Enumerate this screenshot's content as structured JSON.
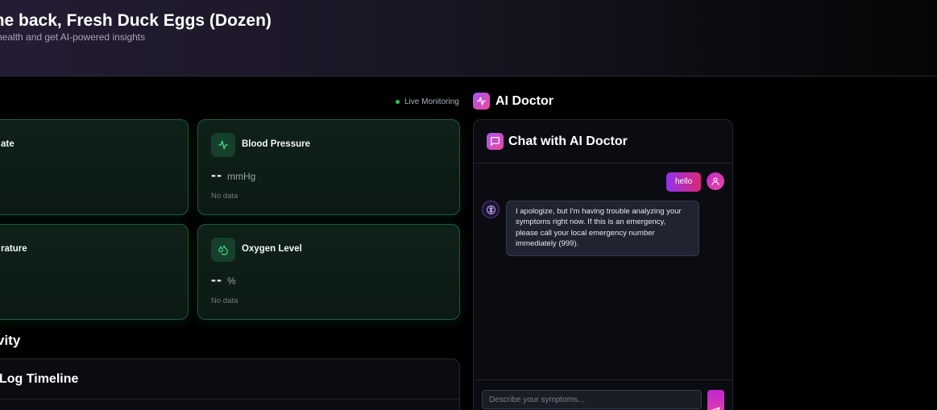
{
  "header": {
    "title": "ome back, Fresh Duck Eggs (Dozen)",
    "subtitle": "ur health and get AI-powered insights"
  },
  "vitals": {
    "live_label": "Live Monitoring",
    "cards": [
      {
        "title": "ate",
        "value": "",
        "unit": "",
        "note": ""
      },
      {
        "title": "Blood Pressure",
        "value": "--",
        "unit": "mmHg",
        "note": "No data",
        "icon": "activity-icon"
      },
      {
        "title": "rature",
        "value": "",
        "unit": "",
        "note": ""
      },
      {
        "title": "Oxygen Level",
        "value": "--",
        "unit": "%",
        "note": "No data",
        "icon": "droplets-icon"
      }
    ]
  },
  "activity": {
    "section_title": "vity",
    "timeline_title": "Log Timeline"
  },
  "ai_doctor": {
    "title": "AI Doctor",
    "chat_title": "Chat with AI Doctor",
    "messages": [
      {
        "role": "user",
        "text": "hello"
      },
      {
        "role": "assistant",
        "text": "I apologize, but I'm having trouble analyzing your symptoms right now. If this is an emergency, please call your local emergency number immediately (999)."
      }
    ],
    "input_placeholder": "Describe your symptoms...",
    "input_value": ""
  },
  "colors": {
    "accent_purple": "#a855f7",
    "accent_pink": "#ec4899",
    "card_green_border": "#1f5a3a",
    "live_dot": "#22c55e"
  }
}
